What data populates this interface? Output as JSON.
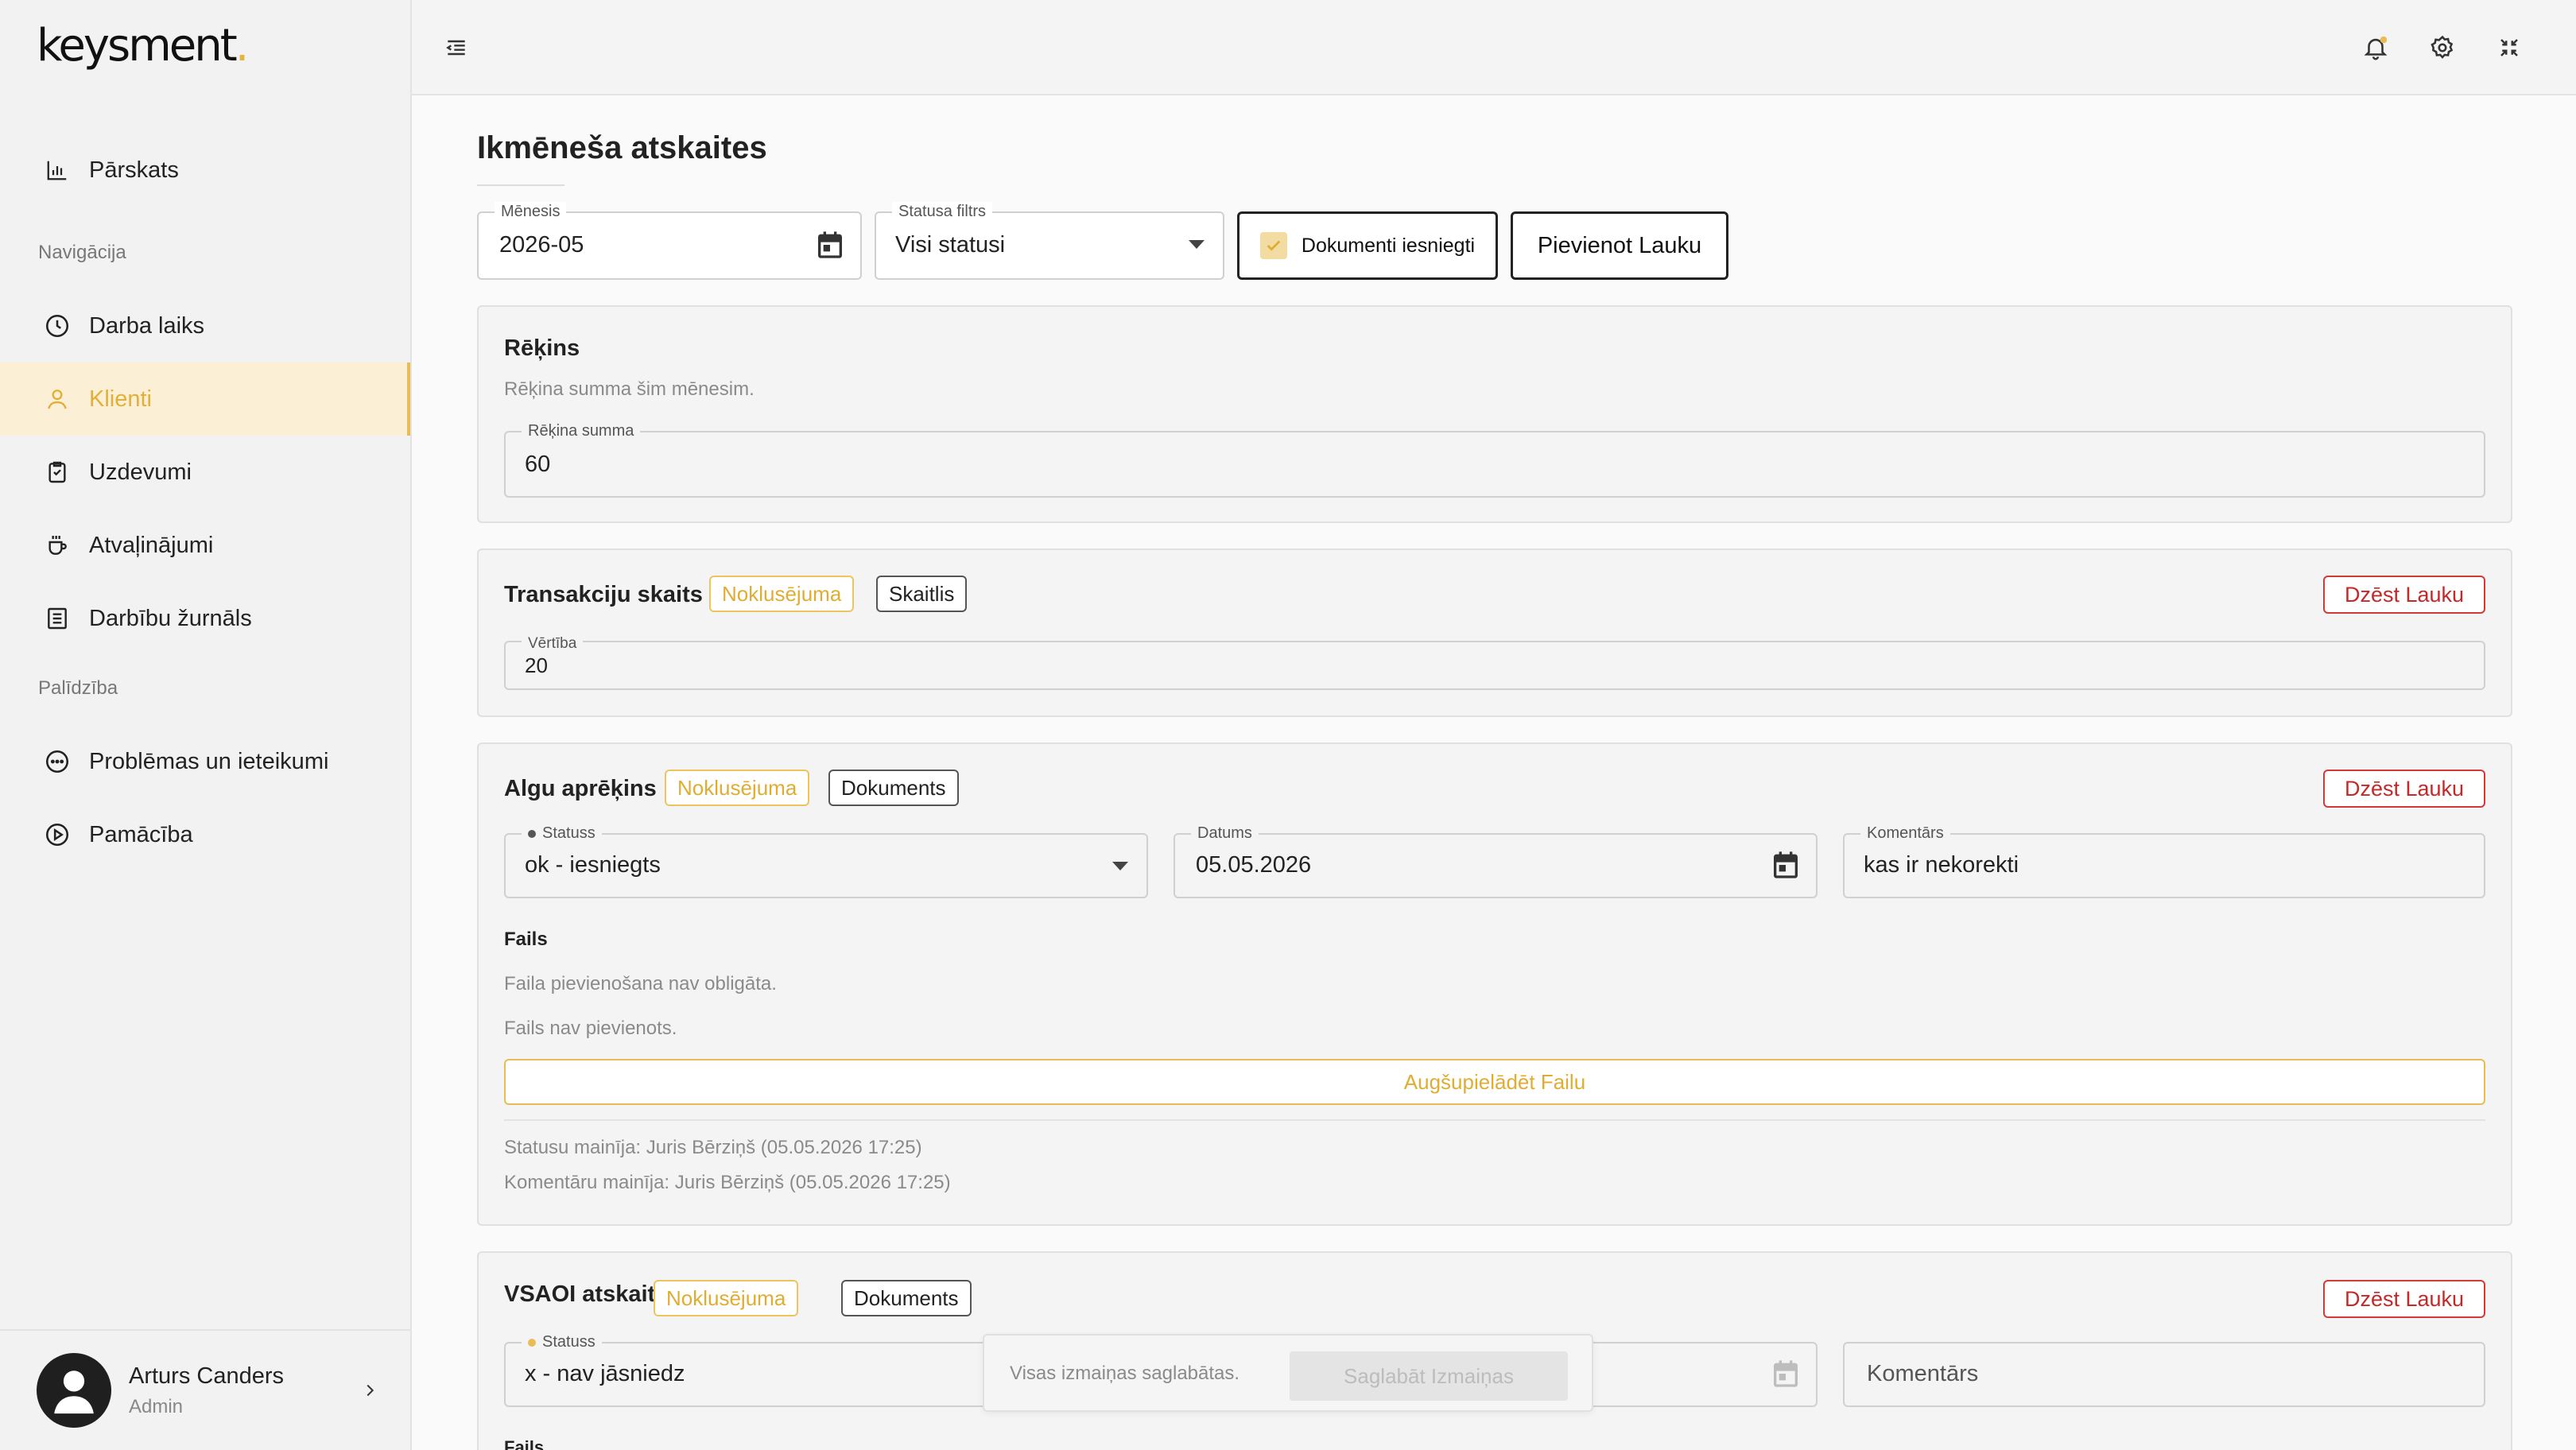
{
  "brand": {
    "logo_text": "keysment",
    "logo_dot": ".",
    "accent": "#e8bd55"
  },
  "sidebar": {
    "top_items": [
      {
        "label": "Pārskats",
        "icon": "bar-chart-icon"
      }
    ],
    "section_navigation": "Navigācija",
    "nav_items": [
      {
        "label": "Darba laiks",
        "icon": "clock-icon"
      },
      {
        "label": "Klienti",
        "icon": "user-icon",
        "active": true
      },
      {
        "label": "Uzdevumi",
        "icon": "clipboard-icon"
      },
      {
        "label": "Atvaļinājumi",
        "icon": "coffee-icon"
      },
      {
        "label": "Darbību žurnāls",
        "icon": "list-icon"
      }
    ],
    "section_help": "Palīdzība",
    "help_items": [
      {
        "label": "Problēmas un ieteikumi",
        "icon": "chat-icon"
      },
      {
        "label": "Pamācība",
        "icon": "play-circle-icon"
      }
    ],
    "user": {
      "name": "Arturs Canders",
      "role": "Admin"
    }
  },
  "page": {
    "title": "Ikmēneša atskaites",
    "filters": {
      "month_label": "Mēnesis",
      "month_value": "2026-05",
      "status_label": "Statusa filtrs",
      "status_value": "Visi statusi",
      "documents_checkbox": "Dokumenti iesniegti",
      "add_field_button": "Pievienot Lauku"
    },
    "invoice": {
      "title": "Rēķins",
      "description": "Rēķina summa šim mēnesim.",
      "amount_label": "Rēķina summa",
      "amount_value": "60"
    },
    "transactions": {
      "title": "Transakciju skaits",
      "chip_default": "Noklusējuma",
      "chip_type": "Skaitlis",
      "delete_button": "Dzēst Lauku",
      "value_label": "Vērtība",
      "value": "20"
    },
    "payroll": {
      "title": "Algu aprēķins",
      "chip_default": "Noklusējuma",
      "chip_type": "Dokuments",
      "delete_button": "Dzēst Lauku",
      "status_label": "Statuss",
      "status_value": "ok - iesniegts",
      "status_dot_color": "#555555",
      "date_label": "Datums",
      "date_value": "05.05.2026",
      "comment_label": "Komentārs",
      "comment_value": "kas ir nekorekti",
      "file_heading": "Fails",
      "file_optional": "Faila pievienošana nav obligāta.",
      "file_missing": "Fails nav pievienots.",
      "upload_button": "Augšupielādēt Failu",
      "status_changed_by": "Statusu mainīja: Juris Bērziņš (05.05.2026 17:25)",
      "comment_changed_by": "Komentāru mainīja: Juris Bērziņš (05.05.2026 17:25)"
    },
    "vsaoi": {
      "title": "VSAOI atskaite",
      "chip_default": "Noklusējuma",
      "chip_type": "Dokuments",
      "delete_button": "Dzēst Lauku",
      "status_label": "Statuss",
      "status_value": "x - nav jāsniedz",
      "status_dot_color": "#e8bd55",
      "comment_placeholder": "Komentārs",
      "file_heading": "Fails"
    },
    "toast": {
      "message": "Visas izmaiņas saglabātas.",
      "save_button": "Saglabāt Izmaiņas"
    }
  }
}
